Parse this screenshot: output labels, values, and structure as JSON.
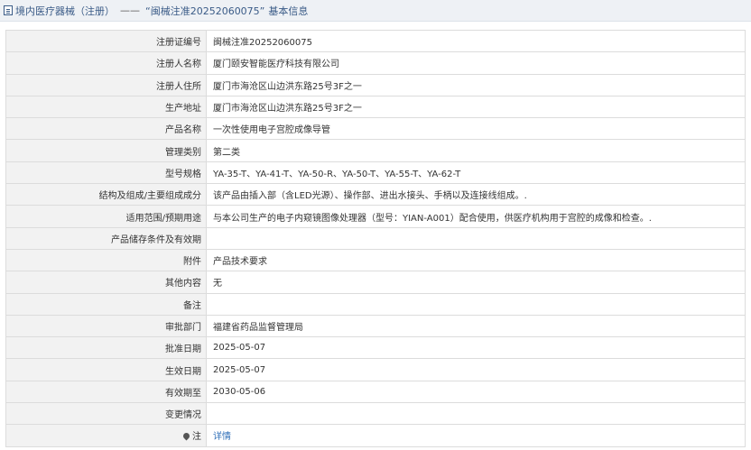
{
  "header": {
    "category": "境内医疗器械（注册）",
    "separator": "——",
    "record": "“闽械注准20252060075”",
    "section": "基本信息"
  },
  "rows": [
    {
      "label": "注册证编号",
      "value": "闽械注准20252060075"
    },
    {
      "label": "注册人名称",
      "value": "厦门颐安智能医疗科技有限公司"
    },
    {
      "label": "注册人住所",
      "value": "厦门市海沧区山边洪东路25号3F之一"
    },
    {
      "label": "生产地址",
      "value": "厦门市海沧区山边洪东路25号3F之一"
    },
    {
      "label": "产品名称",
      "value": "一次性使用电子宫腔成像导管"
    },
    {
      "label": "管理类别",
      "value": "第二类"
    },
    {
      "label": "型号规格",
      "value": "YA-35-T、YA-41-T、YA-50-R、YA-50-T、YA-55-T、YA-62-T"
    },
    {
      "label": "结构及组成/主要组成成分",
      "value": "该产品由插入部（含LED光源）、操作部、进出水接头、手柄以及连接线组成。."
    },
    {
      "label": "适用范围/预期用途",
      "value": "与本公司生产的电子内窥镜图像处理器（型号：YIAN-A001）配合使用，供医疗机构用于宫腔的成像和检查。."
    },
    {
      "label": "产品储存条件及有效期",
      "value": ""
    },
    {
      "label": "附件",
      "value": "产品技术要求"
    },
    {
      "label": "其他内容",
      "value": "无"
    },
    {
      "label": "备注",
      "value": ""
    },
    {
      "label": "审批部门",
      "value": "福建省药品监督管理局"
    },
    {
      "label": "批准日期",
      "value": "2025-05-07"
    },
    {
      "label": "生效日期",
      "value": "2025-05-07"
    },
    {
      "label": "有效期至",
      "value": "2030-05-06"
    },
    {
      "label": "变更情况",
      "value": ""
    }
  ],
  "note": {
    "label": "注",
    "link": "详情",
    "icon": "pin-icon"
  }
}
